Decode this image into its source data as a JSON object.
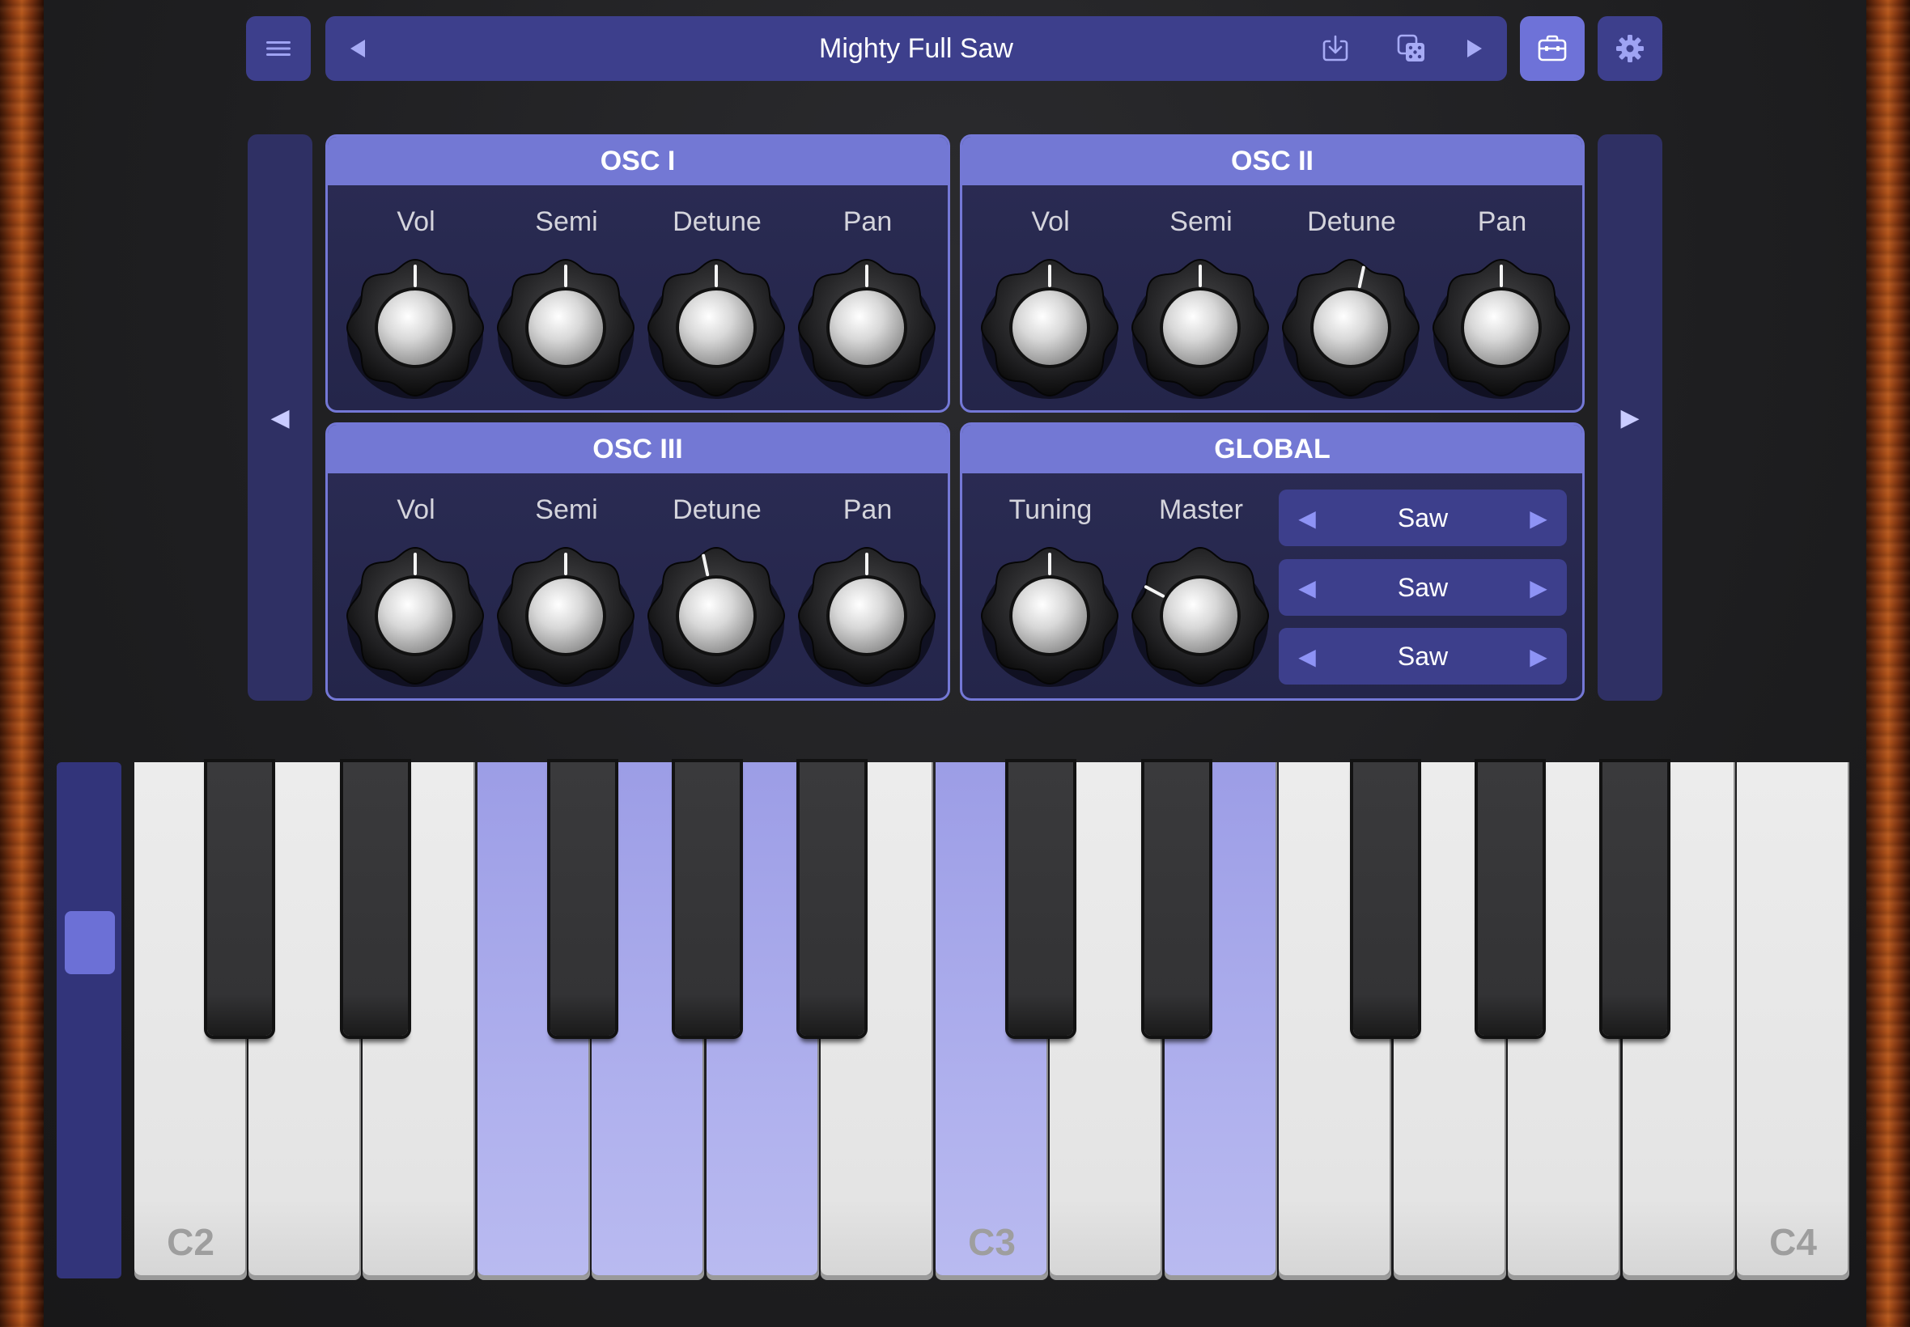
{
  "topbar": {
    "menu_icon": "hamburger-menu-icon",
    "prev_preset_icon": "triangle-left-icon",
    "preset_name": "Mighty Full Saw",
    "save_icon": "download-tray-icon",
    "random_icon": "dice-icon",
    "next_preset_icon": "triangle-right-icon",
    "toolbox_icon": "toolbox-icon",
    "settings_icon": "gear-icon"
  },
  "nav": {
    "left_glyph": "◀",
    "right_glyph": "▶"
  },
  "panels": {
    "osc1": {
      "title": "OSC I",
      "knobs": [
        {
          "label": "Vol"
        },
        {
          "label": "Semi"
        },
        {
          "label": "Detune"
        },
        {
          "label": "Pan"
        }
      ]
    },
    "osc2": {
      "title": "OSC II",
      "knobs": [
        {
          "label": "Vol"
        },
        {
          "label": "Semi"
        },
        {
          "label": "Detune"
        },
        {
          "label": "Pan"
        }
      ]
    },
    "osc3": {
      "title": "OSC III",
      "knobs": [
        {
          "label": "Vol"
        },
        {
          "label": "Semi"
        },
        {
          "label": "Detune"
        },
        {
          "label": "Pan"
        }
      ]
    },
    "global": {
      "title": "GLOBAL",
      "knobs": [
        {
          "label": "Tuning"
        },
        {
          "label": "Master"
        }
      ],
      "waveforms": [
        {
          "value": "Saw"
        },
        {
          "value": "Saw"
        },
        {
          "value": "Saw"
        }
      ],
      "arrow_left": "◀",
      "arrow_right": "▶"
    }
  },
  "keyboard": {
    "labels": {
      "c2": "C2",
      "c3": "C3",
      "c4": "C4"
    }
  },
  "colors": {
    "accent": "#7378d4",
    "panel_bg": "#24254a",
    "button_bg": "#3d3f8c",
    "active_button_bg": "#6e72d8",
    "pressed_key": "#b1b2ee"
  }
}
